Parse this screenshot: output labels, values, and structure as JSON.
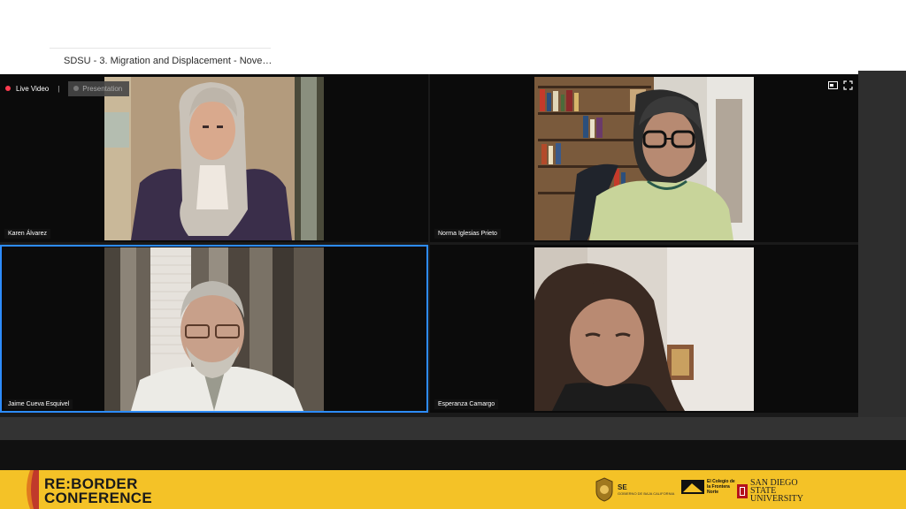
{
  "meeting": {
    "title": "SDSU - 3. Migration and Displacement - Nove…",
    "live_label": "Live Video",
    "separator": "|",
    "presentation_label": "Presentation",
    "participants": [
      {
        "name": "Karen Álvarez"
      },
      {
        "name": "Norma Iglesias Prieto"
      },
      {
        "name": "Jaime Cueva Esquivel"
      },
      {
        "name": "Esperanza Camargo"
      }
    ],
    "active_speaker": "Jaime Cueva Esquivel"
  },
  "controls": {
    "icons": [
      "pip-icon",
      "fullscreen-icon"
    ]
  },
  "footer": {
    "conference_line1": "RE:BORDER",
    "conference_line2": "CONFERENCE",
    "sponsors": [
      {
        "text": "SE",
        "sub": "GOBIERNO DE BAJA CALIFORNIA"
      },
      {
        "text": "El Colegio de la Frontera Norte"
      },
      {
        "text": "SAN DIEGO STATE UNIVERSITY"
      }
    ]
  },
  "colors": {
    "footer_bg": "#f4c227",
    "live_dot": "#ff3b4f",
    "active_border": "#2d8cff",
    "sdsu_red": "#b5121b"
  }
}
